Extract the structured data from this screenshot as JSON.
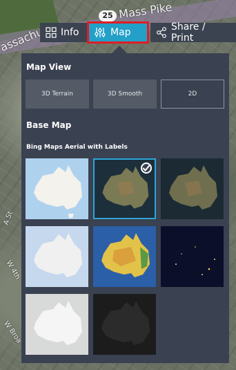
{
  "map": {
    "street_main": "Mass Pike",
    "street_left": "assachuse",
    "route_number": "25",
    "side_streets": [
      "A St",
      "W 4th",
      "W Broa"
    ]
  },
  "toolbar": {
    "info_label": "Info",
    "map_label": "Map",
    "share_label": "Share / Print",
    "info_icon": "grid-icon",
    "map_icon": "sliders-icon",
    "share_icon": "share-icon",
    "accent_color": "#23a0c8",
    "highlight_color": "#e01d24"
  },
  "panel": {
    "map_view_title": "Map View",
    "view_options": [
      "3D Terrain",
      "3D Smooth",
      "2D"
    ],
    "selected_view": "2D",
    "base_map_title": "Base Map",
    "selected_base_map_label": "Bing Maps Aerial with Labels",
    "base_maps": [
      {
        "style": "light-road",
        "selected": false
      },
      {
        "style": "aerial-labels",
        "selected": true
      },
      {
        "style": "aerial",
        "selected": false
      },
      {
        "style": "positron",
        "selected": false
      },
      {
        "style": "terrain-color",
        "selected": false
      },
      {
        "style": "night-lights",
        "selected": false
      },
      {
        "style": "grey-light",
        "selected": false
      },
      {
        "style": "dark-matter",
        "selected": false
      }
    ]
  }
}
